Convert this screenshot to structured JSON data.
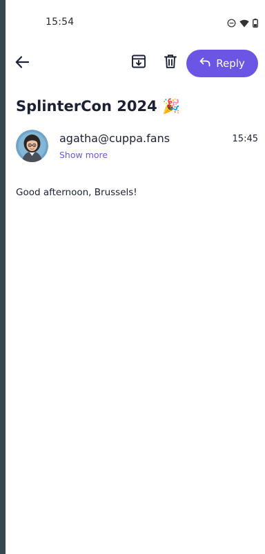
{
  "status_bar": {
    "time": "15:54",
    "icons": [
      "do-not-disturb-icon",
      "wifi-icon",
      "battery-icon"
    ]
  },
  "toolbar": {
    "back_icon": "arrow-left-icon",
    "archive_icon": "archive-icon",
    "delete_icon": "trash-icon",
    "reply_label": "Reply",
    "reply_icon": "reply-arrow-icon"
  },
  "email": {
    "subject": "SplinterCon 2024 🎉",
    "sender": "agatha@cuppa.fans",
    "show_more_label": "Show more",
    "time": "15:45",
    "body": "Good afternoon, Brussels!"
  },
  "colors": {
    "accent": "#6b55e4",
    "text": "#1b2035",
    "frame": "#37474f"
  }
}
